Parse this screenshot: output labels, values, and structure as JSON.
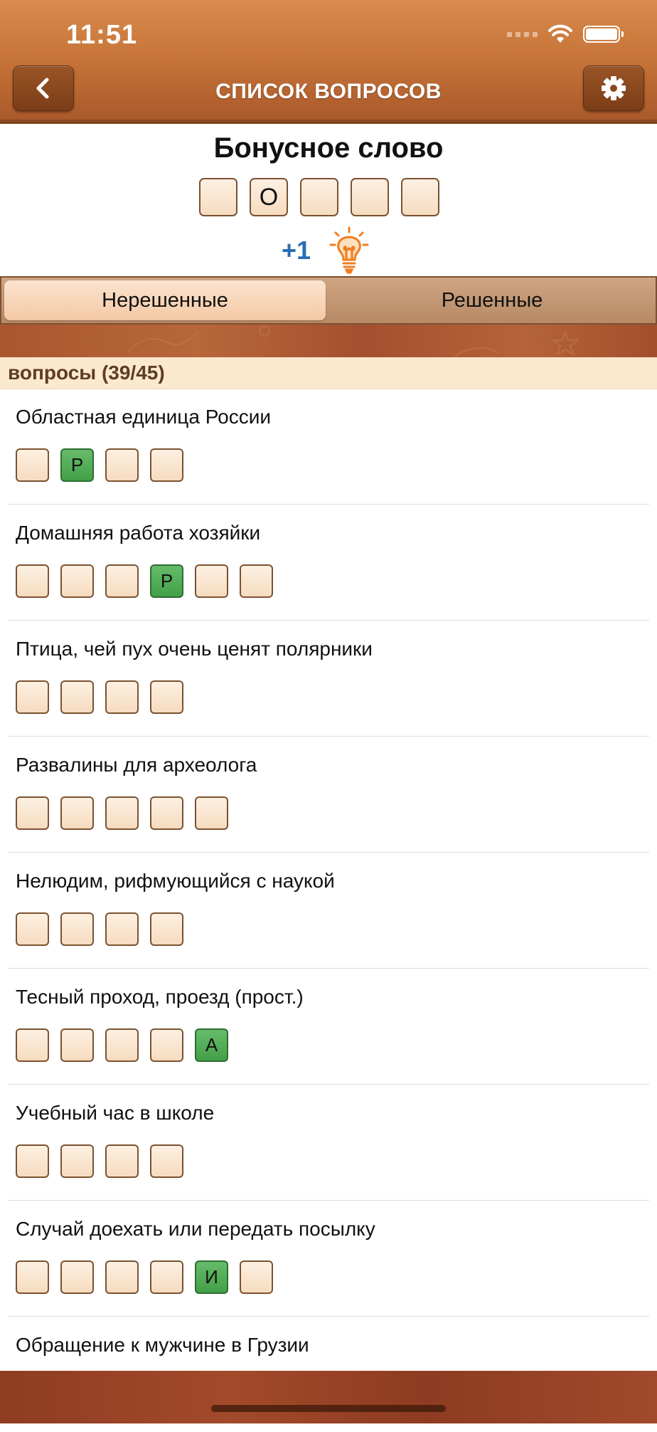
{
  "status_bar": {
    "time": "11:51"
  },
  "header": {
    "title": "СПИСОК ВОПРОСОВ"
  },
  "bonus": {
    "title": "Бонусное слово",
    "letters": [
      "",
      "О",
      "",
      "",
      ""
    ],
    "hint_count": "+1"
  },
  "tabs": [
    {
      "label": "Нерешенные",
      "active": true
    },
    {
      "label": "Решенные",
      "active": false
    }
  ],
  "section": {
    "label": "вопросы (39/45)"
  },
  "questions": [
    {
      "text": "Областная единица России",
      "letters": [
        "",
        "Р",
        "",
        ""
      ]
    },
    {
      "text": "Домашняя работа хозяйки",
      "letters": [
        "",
        "",
        "",
        "Р",
        "",
        ""
      ]
    },
    {
      "text": "Птица, чей пух очень ценят полярники",
      "letters": [
        "",
        "",
        "",
        ""
      ]
    },
    {
      "text": "Развалины для археолога",
      "letters": [
        "",
        "",
        "",
        "",
        ""
      ]
    },
    {
      "text": "Нелюдим, рифмующийся с наукой",
      "letters": [
        "",
        "",
        "",
        ""
      ]
    },
    {
      "text": "Тесный проход, проезд (прост.)",
      "letters": [
        "",
        "",
        "",
        "",
        "А"
      ]
    },
    {
      "text": "Учебный час в школе",
      "letters": [
        "",
        "",
        "",
        ""
      ]
    },
    {
      "text": "Случай доехать или передать посылку",
      "letters": [
        "",
        "",
        "",
        "",
        "И",
        ""
      ]
    },
    {
      "text": "Обращение к мужчине в Грузии",
      "letters": []
    }
  ],
  "colors": {
    "header": "#c8763a",
    "revealed_tile": "#4caf50",
    "hint_count": "#2b6db5",
    "section_bg": "#fbe9cf"
  },
  "icons": [
    "chevron-left-icon",
    "gear-icon",
    "lightbulb-icon",
    "wifi-icon",
    "battery-icon"
  ]
}
